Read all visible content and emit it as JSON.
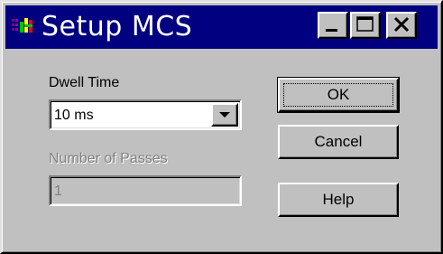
{
  "window": {
    "title": "Setup MCS",
    "titlebar_color": "#000080",
    "face_color": "#c0c0c0"
  },
  "caption_buttons": {
    "minimize_icon": "minimize-icon",
    "maximize_icon": "maximize-icon",
    "close_icon": "close-icon"
  },
  "dwell": {
    "label": "Dwell Time",
    "value": "10 ms"
  },
  "passes": {
    "label": "Number of Passes",
    "value": "1",
    "enabled": false
  },
  "buttons": {
    "ok": "OK",
    "cancel": "Cancel",
    "help": "Help"
  }
}
